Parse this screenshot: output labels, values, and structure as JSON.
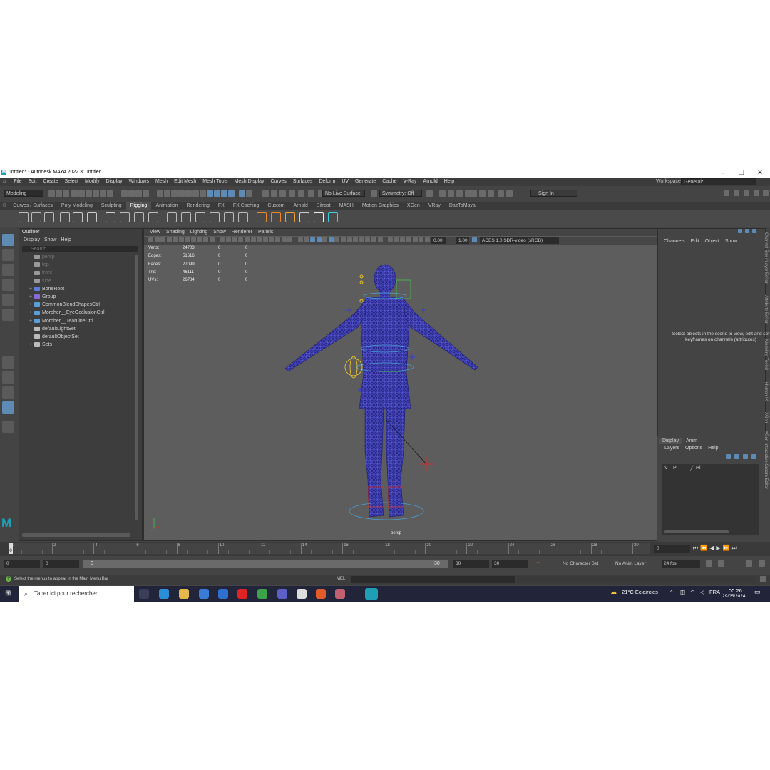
{
  "window": {
    "title": "untitled* - Autodesk MAYA 2022.3: untitled",
    "minimize": "–",
    "maximize": "❐",
    "close": "✕"
  },
  "menubar": [
    "File",
    "Edit",
    "Create",
    "Select",
    "Modify",
    "Display",
    "Windows",
    "Mesh",
    "Edit Mesh",
    "Mesh Tools",
    "Mesh Display",
    "Curves",
    "Surfaces",
    "Deform",
    "UV",
    "Generate",
    "Cache",
    "V-Ray",
    "Arnold",
    "Help"
  ],
  "workspace": {
    "label": "Workspace:",
    "value": "General*"
  },
  "statusline": {
    "mode": "Modeling",
    "live_surface": "No Live Surface",
    "symmetry": "Symmetry: Off",
    "sign_in": "Sign In"
  },
  "shelf_tabs": [
    "Curves / Surfaces",
    "Poly Modeling",
    "Sculpting",
    "Rigging",
    "Animation",
    "Rendering",
    "FX",
    "FX Caching",
    "Custom",
    "Arnold",
    "Bifrost",
    "MASH",
    "Motion Graphics",
    "XGen",
    "VRay",
    "DazToMaya"
  ],
  "shelf_active": "Rigging",
  "outliner": {
    "title": "Outliner",
    "menu": [
      "Display",
      "Show",
      "Help"
    ],
    "search_placeholder": "Search...",
    "items": [
      {
        "label": "persp",
        "dim": true,
        "expander": "",
        "icon": "camera-icon"
      },
      {
        "label": "top",
        "dim": true,
        "expander": "",
        "icon": "camera-icon"
      },
      {
        "label": "front",
        "dim": true,
        "expander": "",
        "icon": "camera-icon"
      },
      {
        "label": "side",
        "dim": true,
        "expander": "",
        "icon": "camera-icon"
      },
      {
        "label": "BoneRoot",
        "dim": false,
        "expander": "+",
        "icon": "joint-icon"
      },
      {
        "label": "Group",
        "dim": false,
        "expander": "+",
        "icon": "group-icon"
      },
      {
        "label": "CommonBlendShapesCtrl",
        "dim": false,
        "expander": "+",
        "icon": "curve-icon"
      },
      {
        "label": "Morpher__EyeOcclusionCtrl",
        "dim": false,
        "expander": "+",
        "icon": "curve-icon"
      },
      {
        "label": "Morpher__TearLineCtrl",
        "dim": false,
        "expander": "+",
        "icon": "curve-icon"
      },
      {
        "label": "defaultLightSet",
        "dim": false,
        "expander": "",
        "icon": "set-icon"
      },
      {
        "label": "defaultObjectSet",
        "dim": false,
        "expander": "",
        "icon": "set-icon"
      },
      {
        "label": "Sets",
        "dim": false,
        "expander": "+",
        "icon": "set-icon"
      }
    ]
  },
  "viewport": {
    "menu": [
      "View",
      "Shading",
      "Lighting",
      "Show",
      "Renderer",
      "Panels"
    ],
    "exposure": "0.00",
    "gamma": "1.00",
    "color_space": "ACES 1.0 SDR-video (sRGB)",
    "camera": "persp",
    "hud": [
      {
        "label": "Verts:",
        "a": "24703",
        "b": "0",
        "c": "0"
      },
      {
        "label": "Edges:",
        "a": "51616",
        "b": "0",
        "c": "0"
      },
      {
        "label": "Faces:",
        "a": "27099",
        "b": "0",
        "c": "0"
      },
      {
        "label": "Tris:",
        "a": "46111",
        "b": "0",
        "c": "0"
      },
      {
        "label": "UVs:",
        "a": "26784",
        "b": "0",
        "c": "0"
      }
    ]
  },
  "channel_box": {
    "menu": [
      "Channels",
      "Edit",
      "Object",
      "Show"
    ],
    "message": "Select objects in the scene to view, edit and set keyframes on channels (attributes)"
  },
  "layer_editor": {
    "tabs": [
      "Display",
      "Anim"
    ],
    "menu": [
      "Layers",
      "Options",
      "Help"
    ],
    "row": {
      "v": "V",
      "p": "P",
      "name": "Hi"
    }
  },
  "side_tabs": [
    "Channel Box / Layer Editor",
    "Attribute Editor",
    "Modeling Toolkit",
    "Human IK",
    "XGen",
    "XGen Interactive Groom Editor"
  ],
  "timeslider": {
    "ticks": [
      "0",
      "2",
      "4",
      "6",
      "8",
      "10",
      "12",
      "14",
      "16",
      "18",
      "20",
      "22",
      "24",
      "26",
      "28",
      "30"
    ],
    "current_frame_marker": "0",
    "current_frame_field": "0"
  },
  "range": {
    "start": "0",
    "anim_start": "0",
    "slider_start": "0",
    "slider_end": "30",
    "playback_end": "30",
    "anim_end": "30",
    "character_set": "No Character Set",
    "anim_layer": "No Anim Layer",
    "fps": "24 fps"
  },
  "helpline": {
    "text": "Select the menus to appear in the Main Menu Bar",
    "mel": "MEL"
  },
  "taskbar": {
    "search_placeholder": "Taper ici pour rechercher",
    "weather": "21°C  Eclaircies",
    "lang": "FRA",
    "time": "00:26",
    "date": "29/05/2024"
  }
}
